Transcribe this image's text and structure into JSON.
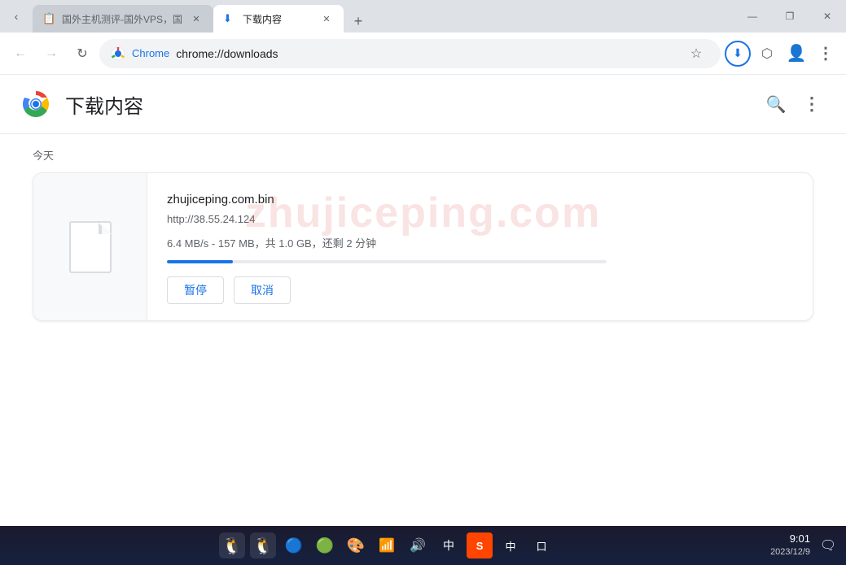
{
  "window": {
    "title": "下载内容",
    "controls": {
      "minimize": "—",
      "maximize": "❐",
      "close": "✕"
    }
  },
  "tabs": [
    {
      "id": "tab1",
      "label": "国外主机测评-国外VPS，国",
      "favicon": "📋",
      "active": false,
      "close": "✕"
    },
    {
      "id": "tab2",
      "label": "下载内容",
      "favicon": "⬇",
      "active": true,
      "close": "✕"
    }
  ],
  "new_tab_icon": "+",
  "nav": {
    "back_icon": "←",
    "forward_icon": "→",
    "reload_icon": "↻",
    "brand": "Chrome",
    "url": "chrome://downloads",
    "bookmark_icon": "☆",
    "download_icon": "⬇",
    "extensions_icon": "⬡",
    "account_icon": "👤",
    "menu_icon": "⋮"
  },
  "page": {
    "title": "下载内容",
    "search_icon": "🔍",
    "menu_icon": "⋮"
  },
  "watermark": "zhujiceping.com",
  "date_label": "今天",
  "download": {
    "filename": "zhujiceping.com.bin",
    "url": "http://38.55.24.124",
    "status": "6.4 MB/s - 157 MB，共 1.0 GB，还剩 2 分钟",
    "progress_percent": 15,
    "btn_pause": "暂停",
    "btn_cancel": "取消"
  },
  "taskbar": {
    "icons": [
      "🐧",
      "🐧",
      "🔵",
      "🟢",
      "🎨",
      "📶",
      "🔊",
      "中"
    ],
    "ime_label": "中",
    "ime_badge_color": "#ff6600",
    "time": "9:01",
    "date": "2023/12/9",
    "notification_icon": "🗨"
  }
}
